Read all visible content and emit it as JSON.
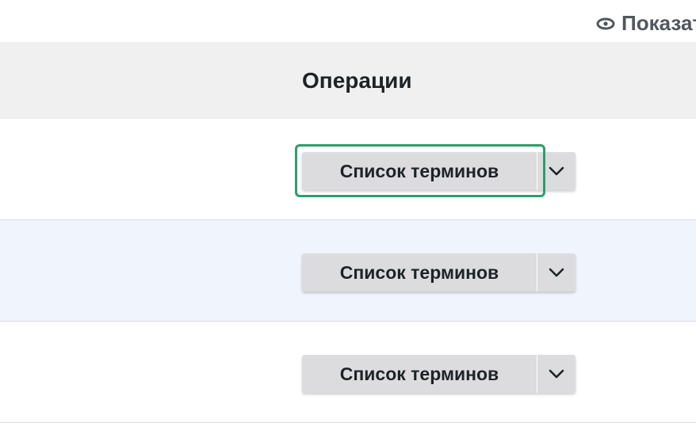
{
  "header": {
    "show_link_label": "Показать",
    "show_link_icon": "eye-icon"
  },
  "table": {
    "column_title": "Операции",
    "rows": [
      {
        "button_label": "Список терминов",
        "toggle_icon": "chevron-down-icon",
        "focused": true
      },
      {
        "button_label": "Список терминов",
        "toggle_icon": "chevron-down-icon",
        "focused": false
      },
      {
        "button_label": "Список терминов",
        "toggle_icon": "chevron-down-icon",
        "focused": false
      }
    ]
  },
  "colors": {
    "header_bg": "#f0f0f1",
    "row_alt_bg": "#f0f4fd",
    "button_bg": "#dcdcde",
    "focus_ring": "#2e9e6a"
  }
}
